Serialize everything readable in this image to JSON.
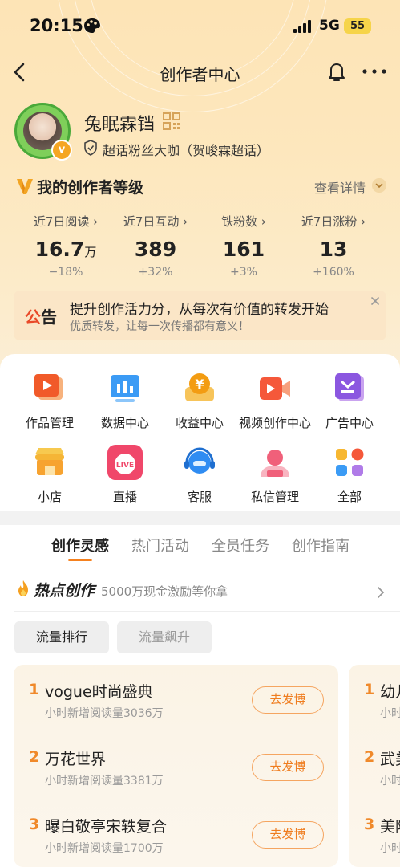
{
  "status_bar": {
    "time": "20:15",
    "network": "5G",
    "battery": "55"
  },
  "nav": {
    "title": "创作者中心"
  },
  "profile": {
    "username": "兔眠霖铛",
    "fan_title": "超话粉丝大咖（贺峻霖超话）"
  },
  "level": {
    "title": "我的创作者等级",
    "detail_link": "查看详情"
  },
  "stats": [
    {
      "label": "近7日阅读 ›",
      "value": "16.7",
      "unit": "万",
      "change": "−18%"
    },
    {
      "label": "近7日互动 ›",
      "value": "389",
      "unit": "",
      "change": "+32%"
    },
    {
      "label": "铁粉数 ›",
      "value": "161",
      "unit": "",
      "change": "+3%"
    },
    {
      "label": "近7日涨粉 ›",
      "value": "13",
      "unit": "",
      "change": "+160%"
    }
  ],
  "notice": {
    "tag_part1": "公",
    "tag_part2": "告",
    "title": "提升创作活力分，从每次有价值的转发开始",
    "subtitle": "优质转发，让每一次传播都有意义！"
  },
  "tools": [
    {
      "label": "作品管理",
      "icon": "works-management-icon"
    },
    {
      "label": "数据中心",
      "icon": "data-center-icon"
    },
    {
      "label": "收益中心",
      "icon": "earnings-center-icon"
    },
    {
      "label": "视频创作中心",
      "icon": "video-creation-icon"
    },
    {
      "label": "广告中心",
      "icon": "ad-center-icon"
    },
    {
      "label": "小店",
      "icon": "shop-icon"
    },
    {
      "label": "直播",
      "icon": "live-icon",
      "icon_text": "LIVE"
    },
    {
      "label": "客服",
      "icon": "customer-service-icon"
    },
    {
      "label": "私信管理",
      "icon": "message-management-icon"
    },
    {
      "label": "全部",
      "icon": "all-icon"
    }
  ],
  "tabs": [
    {
      "label": "创作灵感",
      "active": true
    },
    {
      "label": "热门活动",
      "active": false
    },
    {
      "label": "全员任务",
      "active": false
    },
    {
      "label": "创作指南",
      "active": false
    }
  ],
  "hot": {
    "title": "热点创作",
    "subtitle": "5000万现金激励等你拿"
  },
  "pills": [
    {
      "label": "流量排行",
      "active": true
    },
    {
      "label": "流量飙升",
      "active": false
    }
  ],
  "rank_list": [
    {
      "rank": "1",
      "title": "vogue时尚盛典",
      "sub": "小时新增阅读量3036万",
      "button": "去发博"
    },
    {
      "rank": "2",
      "title": "万花世界",
      "sub": "小时新增阅读量3381万",
      "button": "去发博"
    },
    {
      "rank": "3",
      "title": "曝白敬亭宋轶复合",
      "sub": "小时新增阅读量1700万",
      "button": "去发博"
    }
  ],
  "rank_list_2": [
    {
      "rank": "1",
      "title": "幼儿",
      "sub": "小时"
    },
    {
      "rank": "2",
      "title": "武美",
      "sub": "小时"
    },
    {
      "rank": "3",
      "title": "美阿",
      "sub": "小时"
    }
  ],
  "colors": {
    "accent": "#f5811f",
    "rank": "#f0892a",
    "notice_red": "#e94a29",
    "hero_bg": "#fde4b6"
  }
}
